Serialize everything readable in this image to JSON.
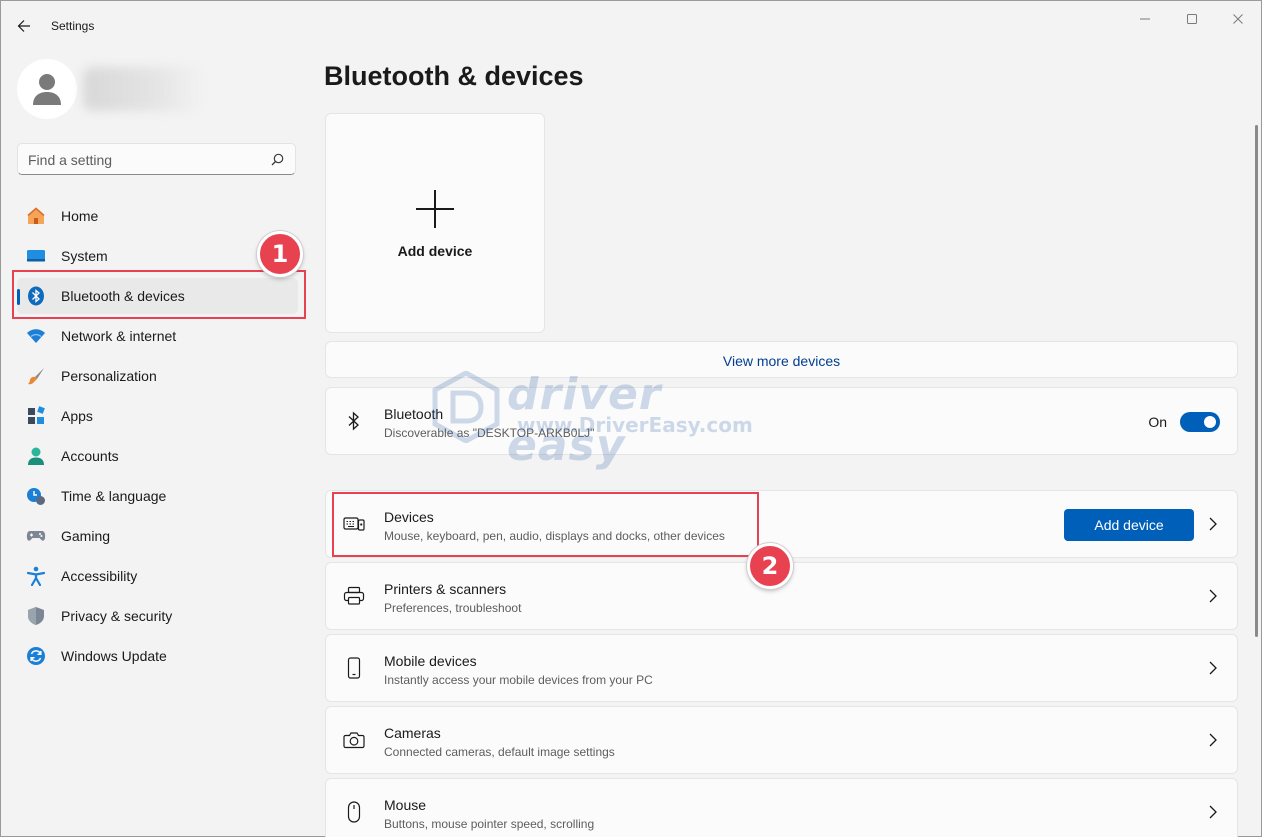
{
  "window": {
    "title": "Settings"
  },
  "search": {
    "placeholder": "Find a setting"
  },
  "sidebar": {
    "items": [
      {
        "label": "Home",
        "icon": "home-icon"
      },
      {
        "label": "System",
        "icon": "system-icon"
      },
      {
        "label": "Bluetooth & devices",
        "icon": "bluetooth-icon",
        "active": true
      },
      {
        "label": "Network & internet",
        "icon": "wifi-icon"
      },
      {
        "label": "Personalization",
        "icon": "brush-icon"
      },
      {
        "label": "Apps",
        "icon": "apps-icon"
      },
      {
        "label": "Accounts",
        "icon": "accounts-icon"
      },
      {
        "label": "Time & language",
        "icon": "clock-globe-icon"
      },
      {
        "label": "Gaming",
        "icon": "gamepad-icon"
      },
      {
        "label": "Accessibility",
        "icon": "accessibility-icon"
      },
      {
        "label": "Privacy & security",
        "icon": "shield-icon"
      },
      {
        "label": "Windows Update",
        "icon": "update-icon"
      }
    ]
  },
  "main": {
    "title": "Bluetooth & devices",
    "add_tile_label": "Add device",
    "view_more": "View more devices",
    "bluetooth": {
      "title": "Bluetooth",
      "subtitle": "Discoverable as \"DESKTOP-ARKB0LJ\"",
      "state_label": "On",
      "enabled": true
    },
    "rows": [
      {
        "title": "Devices",
        "subtitle": "Mouse, keyboard, pen, audio, displays and docks, other devices",
        "button": "Add device",
        "icon": "keyboard-icon"
      },
      {
        "title": "Printers & scanners",
        "subtitle": "Preferences, troubleshoot",
        "icon": "printer-icon"
      },
      {
        "title": "Mobile devices",
        "subtitle": "Instantly access your mobile devices from your PC",
        "icon": "phone-icon"
      },
      {
        "title": "Cameras",
        "subtitle": "Connected cameras, default image settings",
        "icon": "camera-icon"
      },
      {
        "title": "Mouse",
        "subtitle": "Buttons, mouse pointer speed, scrolling",
        "icon": "mouse-icon"
      }
    ]
  },
  "annotations": {
    "step1": "1",
    "step2": "2"
  },
  "watermark": {
    "brand": "driver easy",
    "url": "www.DriverEasy.com"
  },
  "colors": {
    "accent": "#005fb8",
    "annotation": "#e8414f",
    "background": "#f3f3f3",
    "card": "#fbfbfb"
  }
}
